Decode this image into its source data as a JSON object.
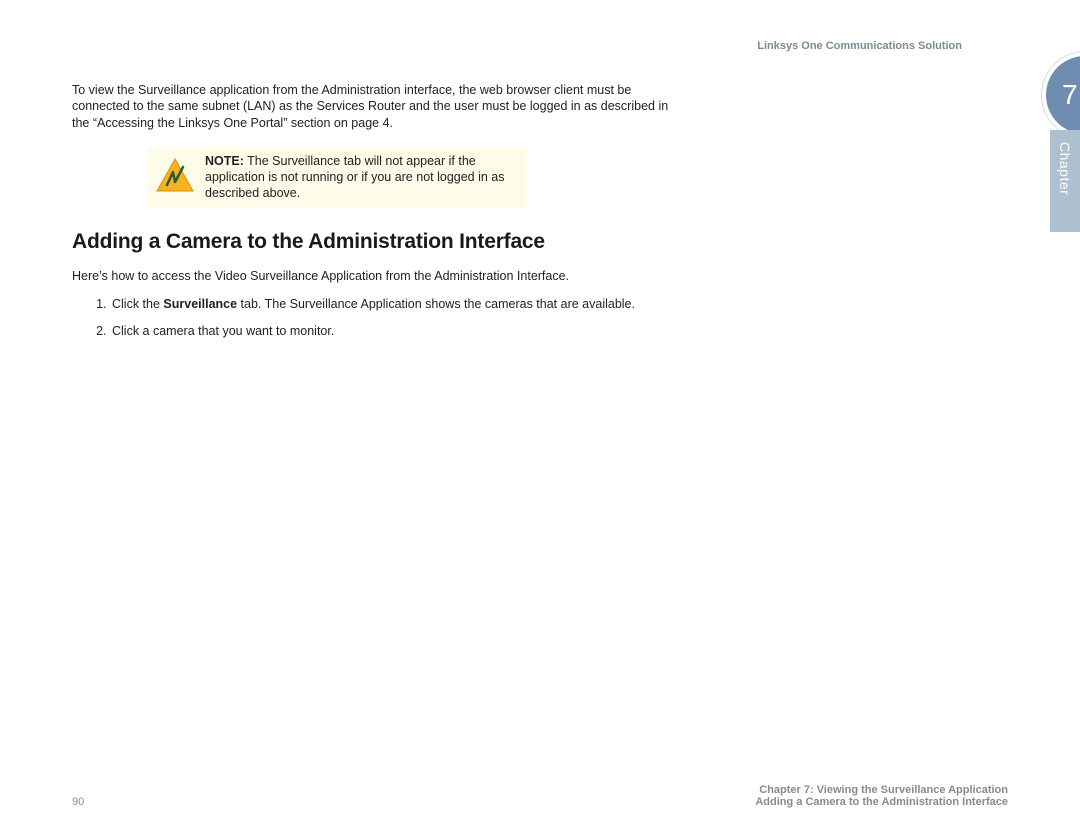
{
  "header": {
    "brandline": "Linksys One Communications Solution"
  },
  "chapter": {
    "number": "7",
    "label": "Chapter"
  },
  "content": {
    "intro": "To view the Surveillance application from the Administration interface, the web browser client must be connected to the same subnet (LAN) as the Services Router and the user must be logged in as described in the “Accessing the Linksys One Portal” section on page 4.",
    "note_label": "NOTE:",
    "note_body": " The Surveillance tab will not appear if the application is not running or if you are not logged in as described above.",
    "heading": "Adding a Camera to the Administration Interface",
    "access_intro": "Here’s how to access the Video Surveillance Application from the Administration Interface.",
    "step1_prefix": "Click the ",
    "step1_bold": "Surveillance",
    "step1_suffix": " tab. The Surveillance Application shows the cameras that are available.",
    "step2": "Click a camera that you want to monitor."
  },
  "footer": {
    "page_number": "90",
    "line1": "Chapter 7: Viewing the Surveillance Application",
    "line2": "Adding a Camera to the Administration Interface"
  }
}
